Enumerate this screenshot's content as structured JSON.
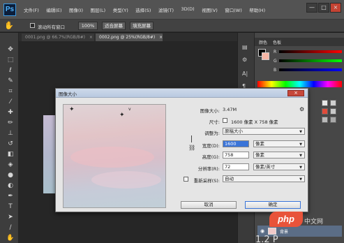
{
  "app": {
    "logo": "Ps",
    "menus": [
      "文件(F)",
      "编辑(E)",
      "图像(I)",
      "图层(L)",
      "类型(Y)",
      "选择(S)",
      "滤镜(T)",
      "3D(D)",
      "视图(V)",
      "窗口(W)",
      "帮助(H)"
    ],
    "window_controls": [
      "—",
      "□",
      "×"
    ]
  },
  "options_bar": {
    "tool_icon": "hand-icon",
    "scroll_all_label": "滚动所有窗口",
    "btn_100": "100%",
    "btn_fit": "适合屏幕",
    "btn_fill": "填充屏幕"
  },
  "tabs": [
    {
      "label": "0001.png @ 66.7%(RGB/8#)",
      "close": "×"
    },
    {
      "label": "0002.png @ 25%(RGB/8#)",
      "close": "×"
    }
  ],
  "panels": {
    "color_tab": "颜色",
    "swatch_tab": "色板",
    "r": "R",
    "g": "G",
    "b": "B",
    "layer_name": "背景",
    "fg_color": "#000000",
    "bg_color": "#f5b6a6"
  },
  "dialog": {
    "title": "图像大小",
    "close": "×",
    "image_size_label": "图像大小:",
    "image_size_value": "3.47M",
    "dimensions_label": "尺寸:",
    "dimensions_value": "1600 像素  X  758 像素",
    "fit_label": "调整为:",
    "fit_value": "原稿大小",
    "width_label": "宽度(D):",
    "width_value": "1600",
    "width_unit": "像素",
    "height_label": "高度(G):",
    "height_value": "758",
    "height_unit": "像素",
    "resolution_label": "分辨率(R):",
    "resolution_value": "72",
    "resolution_unit": "像素/英寸",
    "resample_label": "重新采样(S):",
    "resample_value": "自动",
    "cancel": "取消",
    "ok": "确定"
  },
  "watermark": {
    "text": "php",
    "suffix": "中文网"
  },
  "bottom_text": "1.2 P"
}
